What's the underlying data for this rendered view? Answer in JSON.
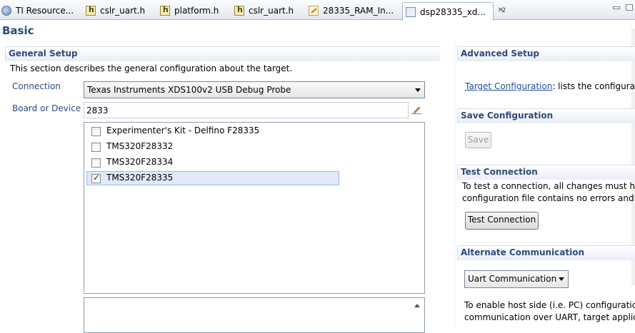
{
  "tabs": [
    {
      "label": "TI Resource...",
      "icon": "globe-icon"
    },
    {
      "label": "cslr_uart.h",
      "icon": "header-file-icon"
    },
    {
      "label": "platform.h",
      "icon": "header-file-icon"
    },
    {
      "label": "cslr_uart.h",
      "icon": "header-file-icon"
    },
    {
      "label": "28335_RAM_In...",
      "icon": "linker-cmd-file-icon"
    },
    {
      "label": "dsp28335_xd...",
      "icon": "target-config-icon",
      "active": true
    }
  ],
  "tabs_overflow": {
    "symbol": "»",
    "count": "2"
  },
  "page": {
    "title": "Basic"
  },
  "general_setup": {
    "title": "General Setup",
    "description": "This section describes the general configuration about the target.",
    "connection_label": "Connection",
    "connection_value": "Texas Instruments XDS100v2 USB Debug Probe",
    "board_label": "Board or Device",
    "board_filter": "2833",
    "devices": [
      {
        "label": "Experimenter's Kit - Delfino F28335",
        "checked": false
      },
      {
        "label": "TMS320F28332",
        "checked": false
      },
      {
        "label": "TMS320F28334",
        "checked": false
      },
      {
        "label": "TMS320F28335",
        "checked": true
      }
    ]
  },
  "advanced_setup": {
    "title": "Advanced Setup",
    "link_text": "Target Configuration",
    "link_suffix": ": lists the configura"
  },
  "save_configuration": {
    "title": "Save Configuration",
    "button": "Save"
  },
  "test_connection": {
    "title": "Test Connection",
    "line1": "To test a connection, all changes must ha",
    "line2": "configuration file contains no errors and",
    "button": "Test Connection"
  },
  "alternate_communication": {
    "title": "Alternate Communication",
    "select_value": "Uart Communication",
    "line1": "To enable host side (i.e. PC) configuratic",
    "line2": "communication over UART, target applic"
  }
}
